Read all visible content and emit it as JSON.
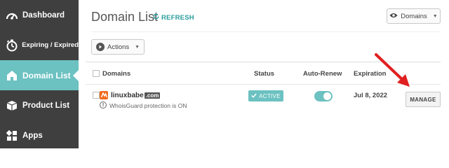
{
  "sidebar": {
    "items": [
      {
        "label": "Dashboard",
        "icon": "dashboard-gauge-icon"
      },
      {
        "label": "Expiring / Expired",
        "icon": "timer-icon"
      },
      {
        "label": "Domain List",
        "icon": "home-icon"
      },
      {
        "label": "Product List",
        "icon": "box-icon"
      },
      {
        "label": "Apps",
        "icon": "apps-grid-icon"
      }
    ],
    "active_index": 2,
    "colors": {
      "background": "#3f3f3f",
      "active": "#6cc1c1"
    }
  },
  "header": {
    "title": "Domain List",
    "refresh_label": "REFRESH",
    "domains_dropdown_label": "Domains"
  },
  "toolbar": {
    "actions_label": "Actions"
  },
  "table": {
    "columns": [
      "Domains",
      "Status",
      "Auto-Renew",
      "Expiration"
    ],
    "rows": [
      {
        "domain_sld": "linuxbabe",
        "domain_tld": ".com",
        "note": "WhoisGuard protection is ON",
        "status": "ACTIVE",
        "auto_renew": true,
        "expiration": "Jul 8, 2022",
        "action_label": "MANAGE"
      }
    ]
  },
  "colors": {
    "accent": "#6cc1c1",
    "link": "#2a9d9d",
    "annotation_arrow": "#e02020",
    "favicon": "#f26b1d"
  }
}
